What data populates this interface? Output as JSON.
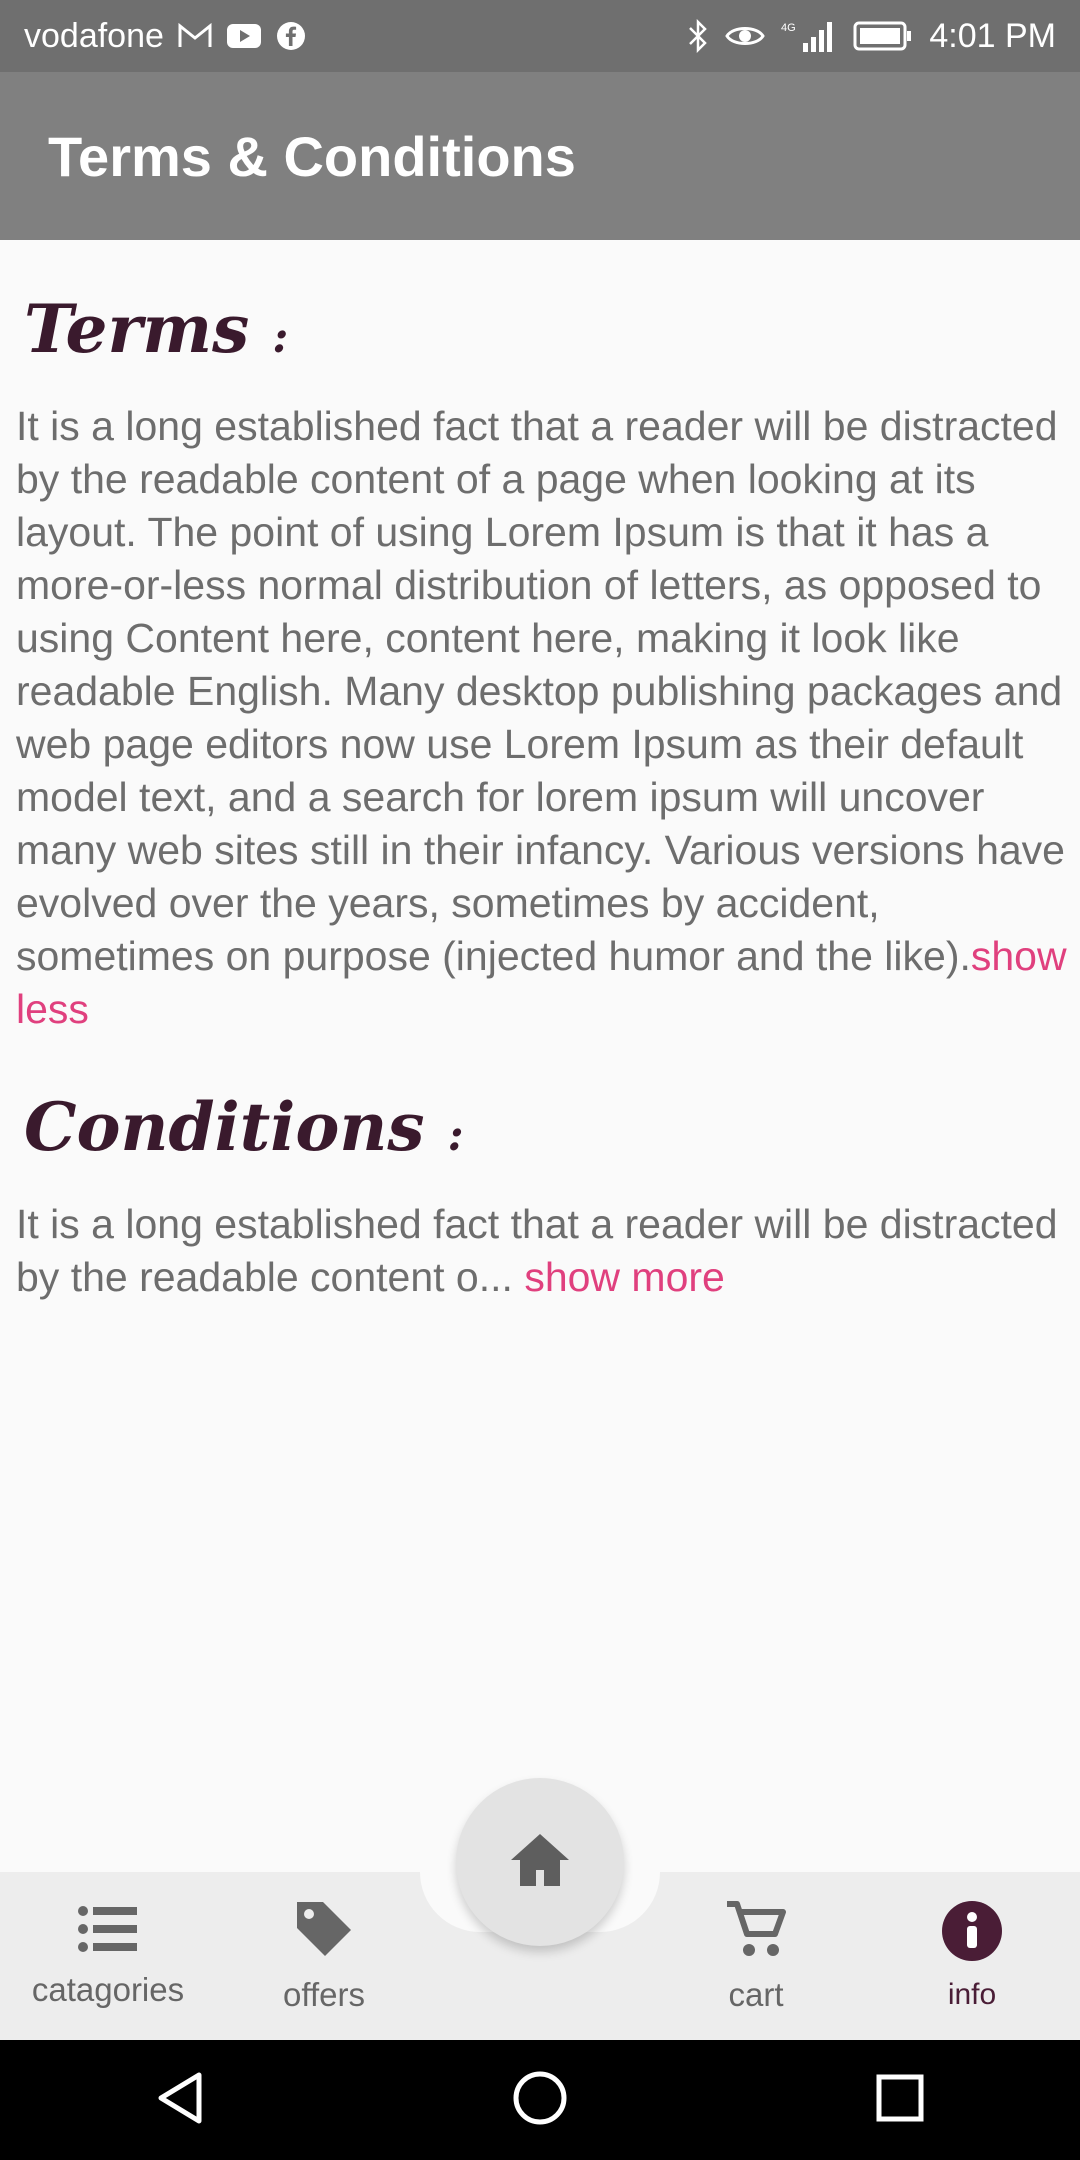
{
  "status_bar": {
    "carrier": "vodafone",
    "network": "4G",
    "time": "4:01 PM",
    "icons": [
      "gmail-icon",
      "youtube-icon",
      "facebook-icon",
      "bluetooth-icon",
      "eye-icon",
      "signal-icon",
      "battery-icon"
    ]
  },
  "app_bar": {
    "title": "Terms & Conditions"
  },
  "terms": {
    "heading": "Terms",
    "colon": ":",
    "body": "It is a long established fact that a reader will be distracted by the readable content of a page when looking at its layout. The point of using Lorem Ipsum is that it has a more-or-less normal distribution of letters, as opposed to using Content here, content here, making it look like readable English. Many desktop publishing packages and web page editors now use Lorem Ipsum as their default model text, and a search for lorem ipsum will uncover many web sites still in their infancy. Various versions have evolved over the years, sometimes by accident, sometimes on purpose (injected humor and the like).",
    "toggle": "show less"
  },
  "conditions": {
    "heading": "Conditions",
    "colon": ":",
    "body": "It is a long established fact that a reader will be distracted by the readable content o...",
    "toggle": "show more"
  },
  "bottom_nav": {
    "items": [
      {
        "label": "catagories",
        "icon": "list-icon"
      },
      {
        "label": "offers",
        "icon": "tag-icon"
      },
      {
        "label": "",
        "icon": "home-icon"
      },
      {
        "label": "cart",
        "icon": "cart-icon"
      },
      {
        "label": "info",
        "icon": "info-icon",
        "active": true
      }
    ]
  },
  "colors": {
    "status_bar": "#6f6f6f",
    "app_bar": "#808080",
    "heading": "#3a1a2d",
    "link": "#e0407e",
    "active_nav": "#4a1d36"
  }
}
